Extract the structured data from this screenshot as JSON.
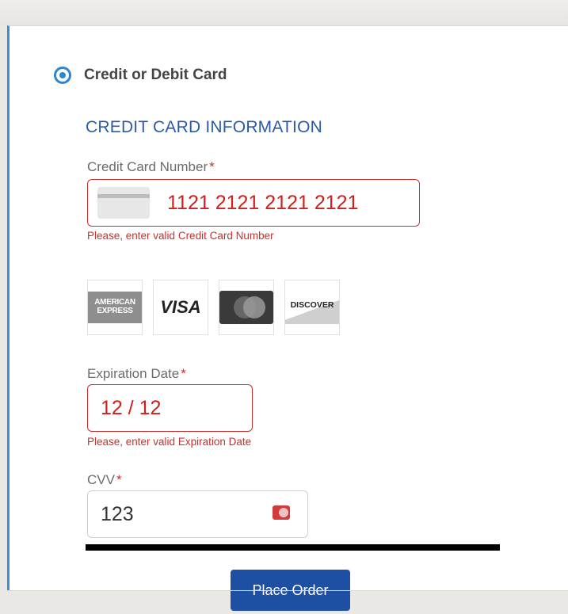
{
  "payment": {
    "method_label": "Credit or Debit Card",
    "section_title": "CREDIT CARD INFORMATION",
    "card_number": {
      "label": "Credit Card Number",
      "required_mark": "*",
      "value": "1121 2121 2121 2121",
      "error": "Please, enter valid Credit Card Number"
    },
    "brands": {
      "amex_line1": "AMERICAN",
      "amex_line2": "EXPRESS",
      "visa": "VISA",
      "discover": "DISCOVER"
    },
    "expiration": {
      "label": "Expiration Date",
      "required_mark": "*",
      "value": "12 / 12",
      "error": "Please, enter valid Expiration Date"
    },
    "cvv": {
      "label": "CVV",
      "required_mark": "*",
      "value": "123"
    },
    "submit_label": "Place Order"
  },
  "colors": {
    "accent": "#2b87d3",
    "error": "#c9302c",
    "button": "#1f4fa3"
  }
}
